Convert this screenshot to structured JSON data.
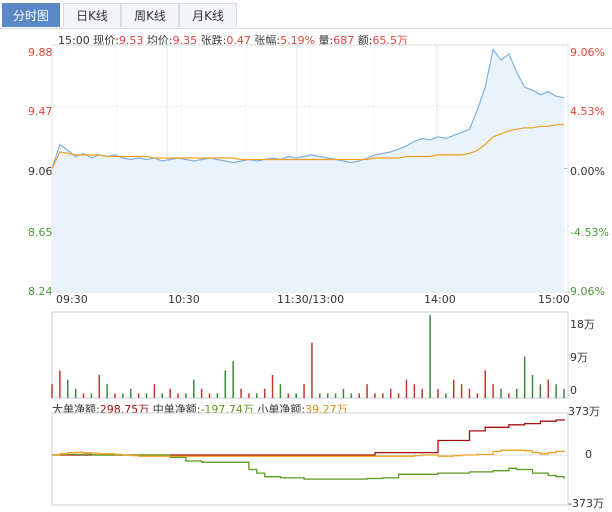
{
  "tabs": [
    {
      "label": "分时图",
      "active": true
    },
    {
      "label": "日K线",
      "active": false
    },
    {
      "label": "周K线",
      "active": false
    },
    {
      "label": "月K线",
      "active": false
    }
  ],
  "info": {
    "time": "15:00",
    "current_label": "现价:",
    "current": "9.53",
    "avg_label": "均价:",
    "avg": "9.35",
    "change_label": "张跌:",
    "change": "0.47",
    "pct_label": "张幅:",
    "pct": "5.19%",
    "vol_label": "量:",
    "vol": "687",
    "amount_label": "额:",
    "amount": "65.5万"
  },
  "price_axis": [
    "9.88",
    "9.47",
    "9.06",
    "8.65",
    "8.24"
  ],
  "pct_axis": [
    "9.06%",
    "4.53%",
    "0.00%",
    "-4.53%",
    "-9.06%"
  ],
  "time_axis": [
    "09:30",
    "10:30",
    "11:30/13:00",
    "14:00",
    "15:00"
  ],
  "volume_axis": [
    "18万",
    "9万",
    "0"
  ],
  "flow": {
    "big_label": "大单净额:",
    "big": "298.75万",
    "mid_label": "中单净额:",
    "mid": "-197.74万",
    "small_label": "小单净额:",
    "small": "39.27万"
  },
  "flow_axis": [
    "373万",
    "0",
    "-373万"
  ],
  "colors": {
    "price": "#7fb0e0",
    "avg": "#f0a020",
    "up": "#c0392b",
    "down": "#3a8a3a",
    "big": "#a01010",
    "mid": "#5a9a20",
    "small": "#f0a020"
  },
  "chart_data": {
    "type": "line",
    "price_range": [
      8.24,
      9.88
    ],
    "prev_close": 9.06,
    "price": [
      9.06,
      9.22,
      9.18,
      9.14,
      9.16,
      9.13,
      9.15,
      9.14,
      9.15,
      9.13,
      9.12,
      9.13,
      9.12,
      9.13,
      9.11,
      9.12,
      9.13,
      9.12,
      9.11,
      9.12,
      9.13,
      9.12,
      9.11,
      9.1,
      9.11,
      9.12,
      9.11,
      9.12,
      9.13,
      9.12,
      9.14,
      9.13,
      9.14,
      9.15,
      9.14,
      9.13,
      9.12,
      9.11,
      9.1,
      9.11,
      9.13,
      9.15,
      9.16,
      9.17,
      9.19,
      9.21,
      9.24,
      9.26,
      9.25,
      9.27,
      9.26,
      9.28,
      9.3,
      9.32,
      9.45,
      9.6,
      9.85,
      9.78,
      9.82,
      9.7,
      9.6,
      9.58,
      9.55,
      9.57,
      9.54,
      9.53
    ],
    "avg": [
      9.06,
      9.17,
      9.16,
      9.15,
      9.15,
      9.15,
      9.15,
      9.14,
      9.14,
      9.14,
      9.14,
      9.14,
      9.14,
      9.13,
      9.13,
      9.13,
      9.13,
      9.13,
      9.13,
      9.13,
      9.13,
      9.13,
      9.13,
      9.13,
      9.12,
      9.12,
      9.12,
      9.12,
      9.12,
      9.12,
      9.12,
      9.12,
      9.12,
      9.12,
      9.12,
      9.12,
      9.12,
      9.12,
      9.12,
      9.12,
      9.12,
      9.13,
      9.13,
      9.13,
      9.13,
      9.14,
      9.14,
      9.14,
      9.14,
      9.15,
      9.15,
      9.15,
      9.15,
      9.16,
      9.18,
      9.22,
      9.27,
      9.29,
      9.31,
      9.32,
      9.33,
      9.33,
      9.34,
      9.34,
      9.35,
      9.35
    ],
    "volume": [
      3,
      6,
      4,
      2,
      1,
      1,
      5,
      3,
      1,
      1,
      2,
      1,
      1,
      3,
      1,
      2,
      1,
      1,
      4,
      2,
      1,
      1,
      6,
      8,
      2,
      1,
      1,
      2,
      5,
      3,
      1,
      1,
      3,
      12,
      1,
      1,
      1,
      2,
      1,
      1,
      3,
      1,
      1,
      2,
      1,
      4,
      3,
      2,
      18,
      2,
      1,
      4,
      3,
      2,
      1,
      6,
      3,
      2,
      1,
      2,
      9,
      5,
      3,
      4,
      3,
      2
    ],
    "big": [
      0,
      0,
      0,
      0,
      0,
      0,
      0,
      0,
      0,
      0,
      0,
      0,
      0,
      0,
      0,
      0,
      0,
      0,
      0,
      0,
      0,
      0,
      0,
      0,
      0,
      0,
      0,
      0,
      0,
      0,
      0,
      0,
      0,
      0,
      0,
      0,
      0,
      0,
      0,
      0,
      0,
      20,
      20,
      20,
      20,
      20,
      20,
      20,
      20,
      120,
      120,
      120,
      120,
      200,
      200,
      230,
      230,
      230,
      250,
      250,
      260,
      260,
      280,
      280,
      290,
      298
    ],
    "mid": [
      0,
      5,
      5,
      5,
      5,
      0,
      0,
      0,
      0,
      0,
      0,
      0,
      0,
      0,
      0,
      -20,
      -20,
      -50,
      -50,
      -60,
      -60,
      -60,
      -60,
      -60,
      -60,
      -120,
      -150,
      -180,
      -180,
      -190,
      -190,
      -190,
      -200,
      -200,
      -200,
      -200,
      -200,
      -200,
      -200,
      -200,
      -195,
      -195,
      -190,
      -190,
      -160,
      -160,
      -160,
      -160,
      -160,
      -150,
      -150,
      -150,
      -150,
      -140,
      -140,
      -140,
      -130,
      -130,
      -110,
      -120,
      -120,
      -150,
      -150,
      -170,
      -180,
      -197
    ],
    "small": [
      0,
      10,
      20,
      22,
      18,
      15,
      12,
      10,
      5,
      0,
      -5,
      -10,
      -10,
      -10,
      -10,
      -10,
      -10,
      -10,
      -10,
      -10,
      -10,
      -10,
      -10,
      -10,
      -10,
      -10,
      -10,
      -10,
      -10,
      -10,
      -10,
      -10,
      -10,
      -10,
      -10,
      -10,
      -10,
      -10,
      -10,
      -10,
      -10,
      -10,
      -10,
      -10,
      -10,
      -10,
      -5,
      0,
      0,
      -10,
      -10,
      -5,
      0,
      0,
      5,
      5,
      30,
      40,
      40,
      40,
      35,
      20,
      10,
      20,
      30,
      39
    ]
  }
}
